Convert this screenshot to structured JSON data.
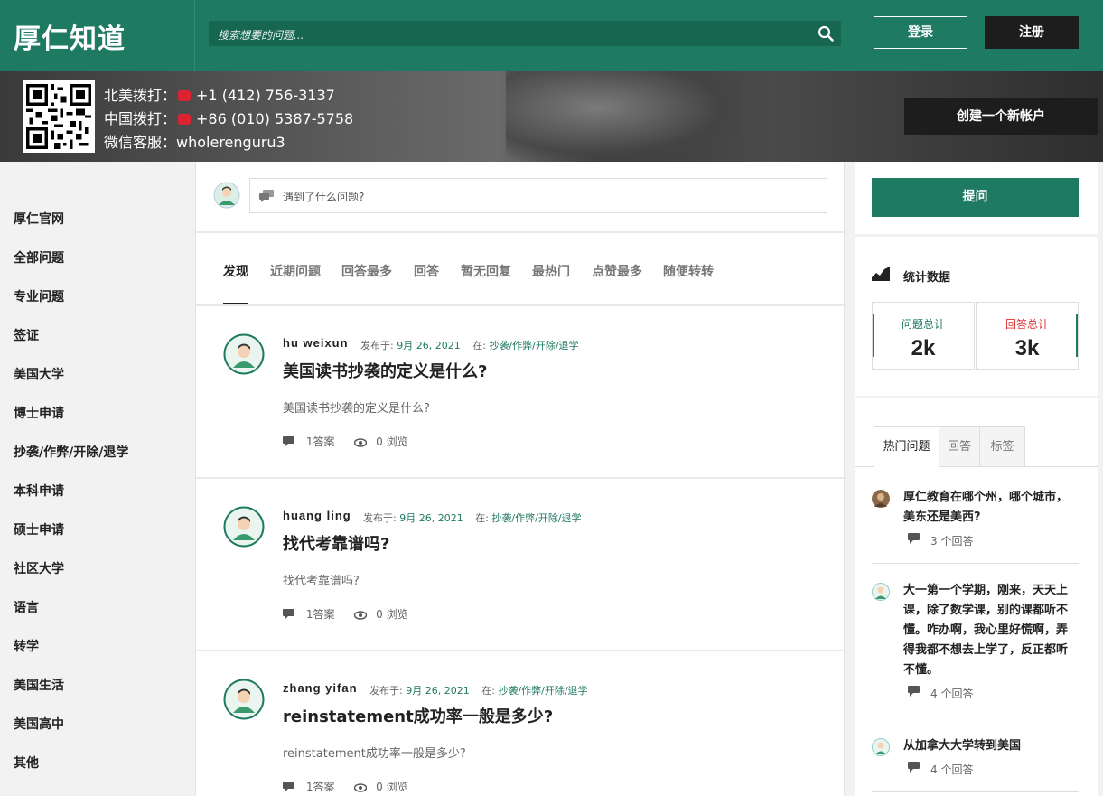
{
  "header": {
    "logo": "厚仁知道",
    "search_placeholder": "搜索想要的问题...",
    "login_label": "登录",
    "register_label": "注册"
  },
  "banner": {
    "line1": "北美拨打：",
    "line1_value": "+1 (412) 756-3137",
    "line2": "中国拨打：",
    "line2_value": "+86 (010) 5387-5758",
    "line3": "微信客服：",
    "line3_value": "wholerenguru3",
    "create_account_label": "创建一个新帐户"
  },
  "sidebar": {
    "items": [
      {
        "label": "厚仁官网"
      },
      {
        "label": "全部问题"
      },
      {
        "label": "专业问题"
      },
      {
        "label": "签证"
      },
      {
        "label": "美国大学"
      },
      {
        "label": "博士申请"
      },
      {
        "label": "抄袭/作弊/开除/退学"
      },
      {
        "label": "本科申请"
      },
      {
        "label": "硕士申请"
      },
      {
        "label": "社区大学"
      },
      {
        "label": "语言"
      },
      {
        "label": "转学"
      },
      {
        "label": "美国生活"
      },
      {
        "label": "美国高中"
      },
      {
        "label": "其他"
      }
    ]
  },
  "ask": {
    "placeholder": "遇到了什么问题?"
  },
  "tabs": [
    {
      "label": "发现"
    },
    {
      "label": "近期问题"
    },
    {
      "label": "回答最多"
    },
    {
      "label": "回答"
    },
    {
      "label": "暂无回复"
    },
    {
      "label": "最热门"
    },
    {
      "label": "点赞最多"
    },
    {
      "label": "随便转转"
    }
  ],
  "questions": [
    {
      "user": "hu weixun",
      "posted_prefix": "发布于:",
      "date": "9月 26, 2021",
      "in_prefix": "在:",
      "category": "抄袭/作弊/开除/退学",
      "title": "美国读书抄袭的定义是什么?",
      "excerpt": "美国读书抄袭的定义是什么?",
      "answers": "1答案",
      "views": "0 浏览"
    },
    {
      "user": "huang ling",
      "posted_prefix": "发布于:",
      "date": "9月 26, 2021",
      "in_prefix": "在:",
      "category": "抄袭/作弊/开除/退学",
      "title": "找代考靠谱吗?",
      "excerpt": "找代考靠谱吗?",
      "answers": "1答案",
      "views": "0 浏览"
    },
    {
      "user": "zhang yifan",
      "posted_prefix": "发布于:",
      "date": "9月 26, 2021",
      "in_prefix": "在:",
      "category": "抄袭/作弊/开除/退学",
      "title": "reinstatement成功率一般是多少?",
      "excerpt": "reinstatement成功率一般是多少?",
      "answers": "1答案",
      "views": "0 浏览"
    }
  ],
  "right": {
    "ask_button": "提问",
    "stats_title": "统计数据",
    "questions_total_label": "问题总计",
    "questions_total": "2k",
    "answers_total_label": "回答总计",
    "answers_total": "3k",
    "hot_tabs": [
      {
        "label": "热门问题"
      },
      {
        "label": "回答"
      },
      {
        "label": "标签"
      }
    ],
    "hot_items": [
      {
        "title": "厚仁教育在哪个州，哪个城市，美东还是美西?",
        "answers": "3 个回答"
      },
      {
        "title": "大一第一个学期，刚来，天天上课，除了数学课，别的课都听不懂。咋办啊，我心里好慌啊，弄得我都不想去上学了，反正都听不懂。",
        "answers": "4 个回答"
      },
      {
        "title": "从加拿大大学转到美国",
        "answers": "4 个回答"
      }
    ]
  },
  "colors": {
    "brand_green": "#1f7a62",
    "dark_button": "#1d1d1d",
    "answers_label_red": "#d33"
  }
}
